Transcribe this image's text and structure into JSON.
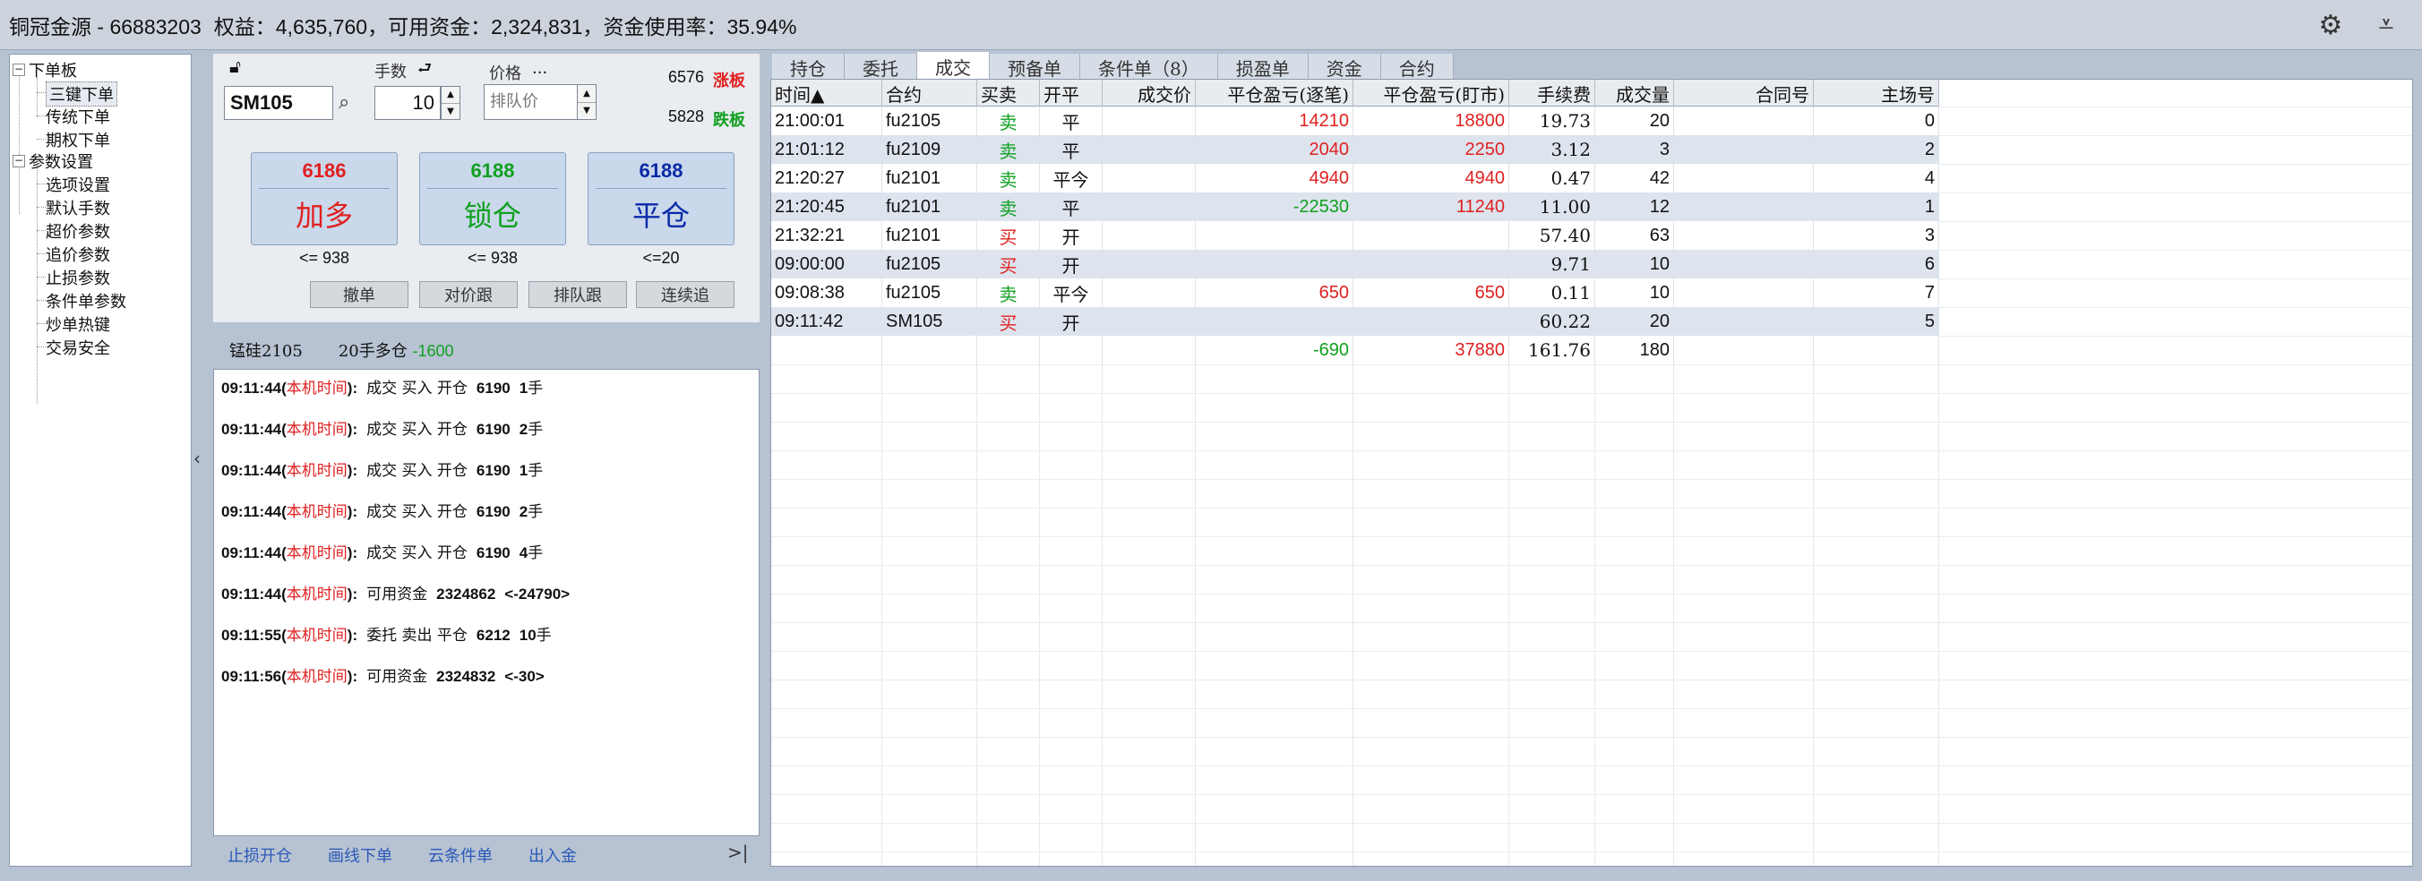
{
  "title": {
    "account": "铜冠金源 - 66883203",
    "equity": "权益：4,635,760，",
    "available": "可用资金：2,324,831，",
    "usage": "资金使用率：35.94%",
    "icons": [
      "gear-icon",
      "minimize-down-icon"
    ]
  },
  "tree": {
    "root1": "下单板",
    "root1_children": [
      "三键下单",
      "传统下单",
      "期权下单"
    ],
    "root2": "参数设置",
    "root2_children": [
      "选项设置",
      "默认手数",
      "超价参数",
      "追价参数",
      "止损参数",
      "条件单参数",
      "炒单热键",
      "交易安全"
    ],
    "expand_glyph": "−"
  },
  "order": {
    "lots_label": "手数",
    "price_label": "价格",
    "price_dots": "...",
    "contract": "SM105",
    "lots": "10",
    "price_placeholder": "排队价",
    "limit_up_price": "6576",
    "limit_up_label": "涨板",
    "limit_down_price": "5828",
    "limit_down_label": "跌板",
    "buttons": [
      {
        "price": "6186",
        "label": "加多",
        "under": "<= 938",
        "color": "#e02020"
      },
      {
        "price": "6188",
        "label": "锁仓",
        "under": "<= 938",
        "color": "#10a020"
      },
      {
        "price": "6188",
        "label": "平仓",
        "under": "<=20",
        "color": "#0a2aa8"
      }
    ],
    "small_buttons": [
      "撤单",
      "对价跟",
      "排队跟",
      "连续追"
    ],
    "position_contract": "锰硅2105",
    "position_text": "20手多仓",
    "position_pnl": "-1600"
  },
  "log": [
    {
      "time": "09:11:44(",
      "local": "本机时间",
      "close": "):",
      "text": "成交  买入  开仓",
      "num": "6190",
      "qty": "1",
      "unit": "手"
    },
    {
      "time": "09:11:44(",
      "local": "本机时间",
      "close": "):",
      "text": "成交  买入  开仓",
      "num": "6190",
      "qty": "2",
      "unit": "手"
    },
    {
      "time": "09:11:44(",
      "local": "本机时间",
      "close": "):",
      "text": "成交  买入  开仓",
      "num": "6190",
      "qty": "1",
      "unit": "手"
    },
    {
      "time": "09:11:44(",
      "local": "本机时间",
      "close": "):",
      "text": "成交  买入  开仓",
      "num": "6190",
      "qty": "2",
      "unit": "手"
    },
    {
      "time": "09:11:44(",
      "local": "本机时间",
      "close": "):",
      "text": "成交  买入  开仓",
      "num": "6190",
      "qty": "4",
      "unit": "手"
    },
    {
      "time": "09:11:44(",
      "local": "本机时间",
      "close": "):",
      "text": "可用资金",
      "num": "2324862",
      "qty": "<-24790>",
      "unit": ""
    },
    {
      "time": "09:11:55(",
      "local": "本机时间",
      "close": "):",
      "text": "委托  卖出  平仓",
      "num": "6212",
      "qty": "10",
      "unit": "手"
    },
    {
      "time": "09:11:56(",
      "local": "本机时间",
      "close": "):",
      "text": "可用资金",
      "num": "2324832",
      "qty": "<-30>",
      "unit": ""
    }
  ],
  "bottom_links": [
    "止损开仓",
    "画线下单",
    "云条件单",
    "出入金"
  ],
  "bottom_end": ">|",
  "tabs": [
    "持仓",
    "委托",
    "成交",
    "预备单",
    "条件单（8）",
    "损盈单",
    "资金",
    "合约"
  ],
  "active_tab": "成交",
  "table": {
    "headers": [
      "时间▲",
      "合约",
      "买卖",
      "开平",
      "成交价",
      "平仓盈亏(逐笔)",
      "平仓盈亏(盯市)",
      "手续费",
      "成交量",
      "合同号",
      "主场号"
    ],
    "rows": [
      {
        "time": "21:00:01",
        "contract": "fu2105",
        "side": "卖",
        "oc": "平",
        "price": "",
        "pnl1": "14210",
        "pnl2": "18800",
        "fee": "19.73",
        "vol": "20",
        "cno": "",
        "mno": "0"
      },
      {
        "time": "21:01:12",
        "contract": "fu2109",
        "side": "卖",
        "oc": "平",
        "price": "",
        "pnl1": "2040",
        "pnl2": "2250",
        "fee": "3.12",
        "vol": "3",
        "cno": "",
        "mno": "2"
      },
      {
        "time": "21:20:27",
        "contract": "fu2101",
        "side": "卖",
        "oc": "平今",
        "price": "",
        "pnl1": "4940",
        "pnl2": "4940",
        "fee": "0.47",
        "vol": "42",
        "cno": "",
        "mno": "4"
      },
      {
        "time": "21:20:45",
        "contract": "fu2101",
        "side": "卖",
        "oc": "平",
        "price": "",
        "pnl1": "-22530",
        "pnl2": "11240",
        "fee": "11.00",
        "vol": "12",
        "cno": "",
        "mno": "1"
      },
      {
        "time": "21:32:21",
        "contract": "fu2101",
        "side": "买",
        "oc": "开",
        "price": "",
        "pnl1": "",
        "pnl2": "",
        "fee": "57.40",
        "vol": "63",
        "cno": "",
        "mno": "3"
      },
      {
        "time": "09:00:00",
        "contract": "fu2105",
        "side": "买",
        "oc": "开",
        "price": "",
        "pnl1": "",
        "pnl2": "",
        "fee": "9.71",
        "vol": "10",
        "cno": "",
        "mno": "6"
      },
      {
        "time": "09:08:38",
        "contract": "fu2105",
        "side": "卖",
        "oc": "平今",
        "price": "",
        "pnl1": "650",
        "pnl2": "650",
        "fee": "0.11",
        "vol": "10",
        "cno": "",
        "mno": "7"
      },
      {
        "time": "09:11:42",
        "contract": "SM105",
        "side": "买",
        "oc": "开",
        "price": "",
        "pnl1": "",
        "pnl2": "",
        "fee": "60.22",
        "vol": "20",
        "cno": "",
        "mno": "5"
      }
    ],
    "total": {
      "pnl1": "-690",
      "pnl2": "37880",
      "fee": "161.76",
      "vol": "180"
    }
  },
  "colors": {
    "buy": "#e02020",
    "sell": "#10a020",
    "profit": "#e02020",
    "loss": "#10a020"
  }
}
